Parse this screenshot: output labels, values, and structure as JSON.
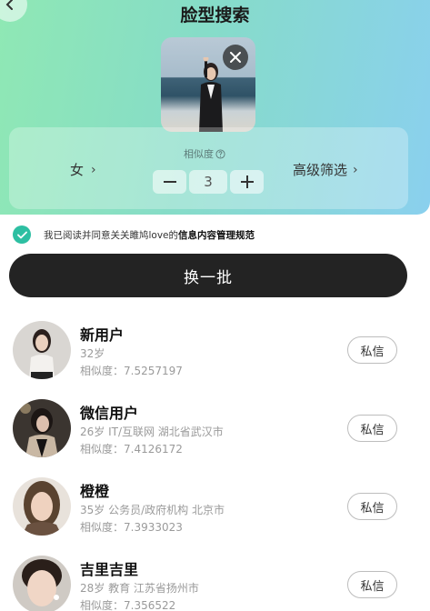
{
  "header": {
    "title": "脸型搜索"
  },
  "filter": {
    "gender_label": "女",
    "similarity_label": "相似度",
    "similarity_value": "3",
    "advanced_label": "高级筛选"
  },
  "agreement": {
    "prefix": "我已阅读并同意关关雎鸠love的",
    "link": "信息内容管理规范",
    "checked": true
  },
  "refresh_button": "换一批",
  "colors": {
    "accent": "#2dbfa2",
    "button_dark": "#232323"
  },
  "users": [
    {
      "name": "新用户",
      "meta": "32岁",
      "similarity": "相似度：7.5257197",
      "action": "私信"
    },
    {
      "name": "微信用户",
      "meta": "26岁 IT/互联网 湖北省武汉市",
      "similarity": "相似度：7.4126172",
      "action": "私信"
    },
    {
      "name": "橙橙",
      "meta": "35岁 公务员/政府机构 北京市",
      "similarity": "相似度：7.3933023",
      "action": "私信"
    },
    {
      "name": "吉里吉里",
      "meta": "28岁 教育 江苏省扬州市",
      "similarity": "相似度：7.356522",
      "action": "私信"
    }
  ]
}
